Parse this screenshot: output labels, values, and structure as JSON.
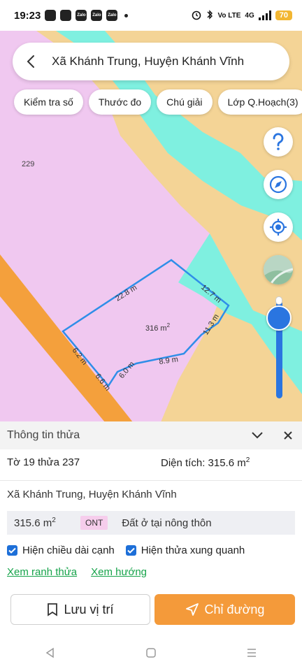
{
  "status_bar": {
    "time": "19:23",
    "notification_icons": [
      "messenger-icon",
      "messenger-icon",
      "zalo-icon",
      "zalo-icon",
      "zalo-icon"
    ],
    "notification_labels": [
      "",
      "",
      "Zalo",
      "Zalo",
      "Zalo"
    ],
    "network_label": "Vo LTE",
    "network_type": "4G",
    "battery": "70"
  },
  "search": {
    "title": "Xã Khánh Trung, Huyện Khánh Vĩnh"
  },
  "chips": [
    "Kiểm tra số",
    "Thước đo",
    "Chú giải",
    "Lớp Q.Hoạch(3)"
  ],
  "map": {
    "parcel_label": "229",
    "edges": [
      "22.8 m",
      "12.7 m",
      "11.3 m",
      "8.9 m",
      "6.0 m",
      "6.6 m",
      "6.2 m"
    ],
    "area_text": "316 m",
    "area_sup": "2",
    "colors": {
      "land": "#f4d496",
      "residential": "#f0c8f0",
      "water": "#7ff0e0",
      "road": "#f4a03c",
      "boundary": "#2f8ee8"
    }
  },
  "right_controls": [
    "help-icon",
    "compass-icon",
    "my-location-icon",
    "map-layer-icon"
  ],
  "sheet": {
    "title": "Thông tin thửa",
    "sheet_no": "Tờ 19 thửa 237",
    "area_label": "Diện tích: 315.6 m",
    "area_sup": "2",
    "address": "Xã Khánh Trung, Huyện Khánh Vĩnh",
    "land_area": "315.6 m",
    "land_area_sup": "2",
    "land_code": "ONT",
    "land_type": "Đất ở tại nông thôn",
    "check_edges": "Hiện chiều dài cạnh",
    "check_neighbors": "Hiện thửa xung quanh",
    "link_boundary": "Xem ranh thửa",
    "link_direction": "Xem hướng",
    "save_label": "Lưu vị trí",
    "route_label": "Chỉ đường"
  }
}
